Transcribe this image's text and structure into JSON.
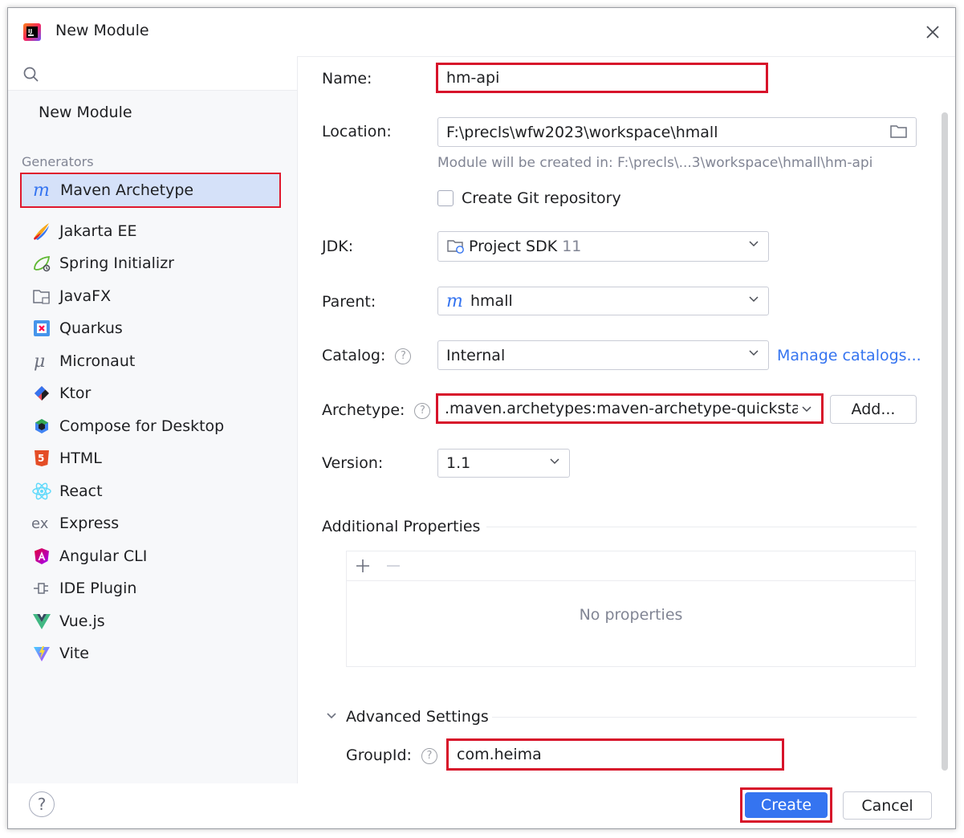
{
  "window": {
    "title": "New Module"
  },
  "sidebar": {
    "top_item": "New Module",
    "generators_label": "Generators",
    "items": [
      {
        "label": "Maven Archetype",
        "icon": "maven-icon",
        "selected": true
      },
      {
        "label": "Jakarta EE",
        "icon": "jakarta-ee-icon"
      },
      {
        "label": "Spring Initializr",
        "icon": "spring-icon"
      },
      {
        "label": "JavaFX",
        "icon": "folder-icon"
      },
      {
        "label": "Quarkus",
        "icon": "quarkus-icon"
      },
      {
        "label": "Micronaut",
        "icon": "micronaut-icon"
      },
      {
        "label": "Ktor",
        "icon": "ktor-icon"
      },
      {
        "label": "Compose for Desktop",
        "icon": "compose-icon"
      },
      {
        "label": "HTML",
        "icon": "html5-icon"
      },
      {
        "label": "React",
        "icon": "react-icon"
      },
      {
        "label": "Express",
        "icon": "express-icon"
      },
      {
        "label": "Angular CLI",
        "icon": "angular-icon"
      },
      {
        "label": "IDE Plugin",
        "icon": "plugin-icon"
      },
      {
        "label": "Vue.js",
        "icon": "vue-icon"
      },
      {
        "label": "Vite",
        "icon": "vite-icon"
      }
    ]
  },
  "form": {
    "name_label": "Name:",
    "name_value": "hm-api",
    "location_label": "Location:",
    "location_value": "F:\\precls\\wfw2023\\workspace\\hmall",
    "location_hint": "Module will be created in: F:\\precls\\...3\\workspace\\hmall\\hm-api",
    "git_label": "Create Git repository",
    "jdk_label": "JDK:",
    "jdk_value": "Project SDK",
    "jdk_version": "11",
    "parent_label": "Parent:",
    "parent_value": "hmall",
    "catalog_label": "Catalog:",
    "catalog_value": "Internal",
    "manage_catalogs": "Manage catalogs...",
    "archetype_label": "Archetype:",
    "archetype_value": ".maven.archetypes:maven-archetype-quicksta",
    "add_button": "Add...",
    "version_label": "Version:",
    "version_value": "1.1",
    "additional_properties": "Additional Properties",
    "no_properties": "No properties",
    "advanced_settings": "Advanced Settings",
    "groupid_label": "GroupId:",
    "groupid_value": "com.heima",
    "help_glyph": "?"
  },
  "footer": {
    "help_glyph": "?",
    "create_button": "Create",
    "cancel_button": "Cancel"
  },
  "colors": {
    "accent": "#3574f0",
    "highlight_border": "#d7132a",
    "selection_bg": "#d5e1f9"
  }
}
